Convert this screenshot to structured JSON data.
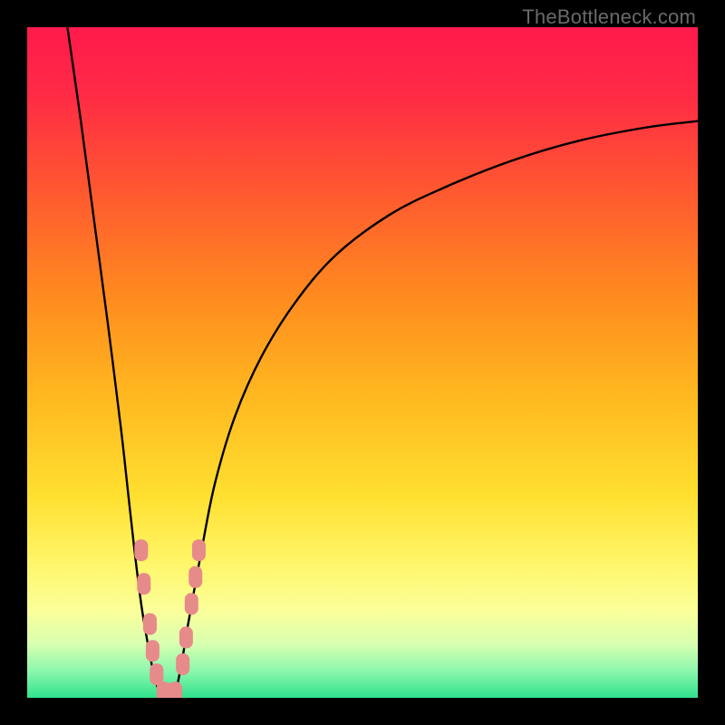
{
  "watermark": "TheBottleneck.com",
  "colors": {
    "frame": "#000000",
    "curve": "#000000",
    "marker_fill": "#e78a8a",
    "marker_stroke": "#c66",
    "gradient_stops": [
      {
        "offset": 0.0,
        "color": "#ff1a4d"
      },
      {
        "offset": 0.1,
        "color": "#ff2a45"
      },
      {
        "offset": 0.25,
        "color": "#ff5a2f"
      },
      {
        "offset": 0.4,
        "color": "#ff8a1f"
      },
      {
        "offset": 0.55,
        "color": "#ffb81f"
      },
      {
        "offset": 0.7,
        "color": "#ffe030"
      },
      {
        "offset": 0.8,
        "color": "#fff66a"
      },
      {
        "offset": 0.87,
        "color": "#fbff9a"
      },
      {
        "offset": 0.92,
        "color": "#d8ffb0"
      },
      {
        "offset": 0.96,
        "color": "#8cf7ad"
      },
      {
        "offset": 1.0,
        "color": "#2fe28d"
      }
    ]
  },
  "chart_data": {
    "type": "line",
    "title": "",
    "xlabel": "",
    "ylabel": "",
    "xlim": [
      0,
      100
    ],
    "ylim": [
      0,
      100
    ],
    "grid": false,
    "legend": false,
    "series": [
      {
        "name": "left-curve",
        "x": [
          6,
          8,
          10,
          12,
          14,
          15,
          16,
          17,
          18,
          19,
          20
        ],
        "y": [
          100,
          86,
          71,
          56,
          40,
          31,
          22,
          14,
          8,
          3,
          0
        ]
      },
      {
        "name": "right-curve",
        "x": [
          22,
          23,
          24,
          26,
          28,
          31,
          35,
          40,
          46,
          54,
          62,
          72,
          82,
          92,
          100
        ],
        "y": [
          0,
          5,
          11,
          22,
          32,
          42,
          51,
          59,
          66,
          72,
          76,
          80,
          83,
          85,
          86
        ]
      }
    ],
    "markers": {
      "name": "highlighted-points",
      "shape": "pill",
      "points": [
        {
          "x": 17.0,
          "y": 22
        },
        {
          "x": 17.4,
          "y": 17
        },
        {
          "x": 18.3,
          "y": 11
        },
        {
          "x": 18.7,
          "y": 7
        },
        {
          "x": 19.3,
          "y": 3.5
        },
        {
          "x": 20.3,
          "y": 0.8
        },
        {
          "x": 21.2,
          "y": 0.6
        },
        {
          "x": 22.1,
          "y": 0.8
        },
        {
          "x": 23.2,
          "y": 5
        },
        {
          "x": 23.7,
          "y": 9
        },
        {
          "x": 24.5,
          "y": 14
        },
        {
          "x": 25.1,
          "y": 18
        },
        {
          "x": 25.6,
          "y": 22
        }
      ]
    }
  }
}
